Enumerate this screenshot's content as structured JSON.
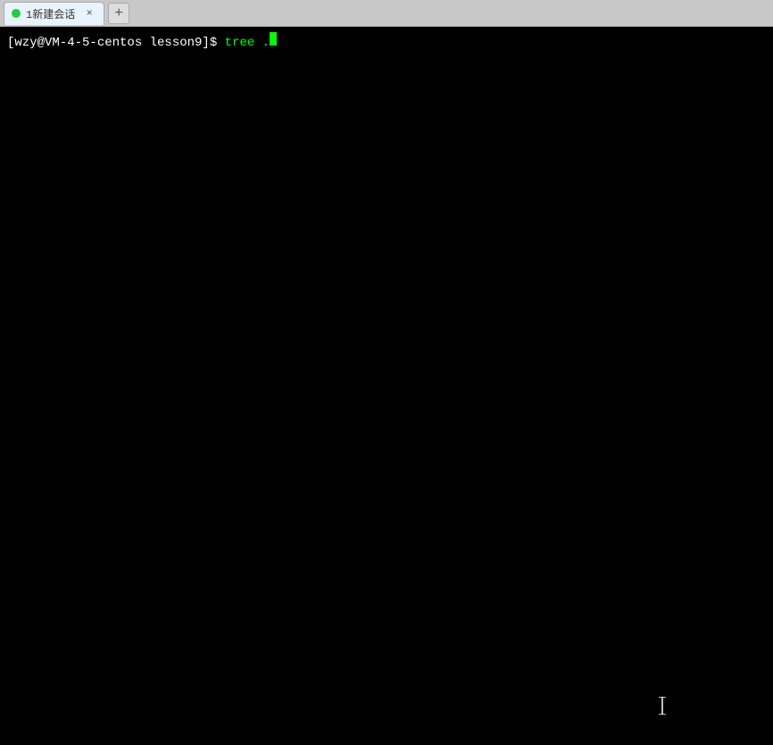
{
  "tabBar": {
    "addButton": "+",
    "tab": {
      "label": "1新建会话",
      "closeLabel": "×"
    }
  },
  "terminal": {
    "prompt": "[wzy@VM-4-5-centos lesson9]$",
    "command": " tree .",
    "cursorChar": ""
  }
}
